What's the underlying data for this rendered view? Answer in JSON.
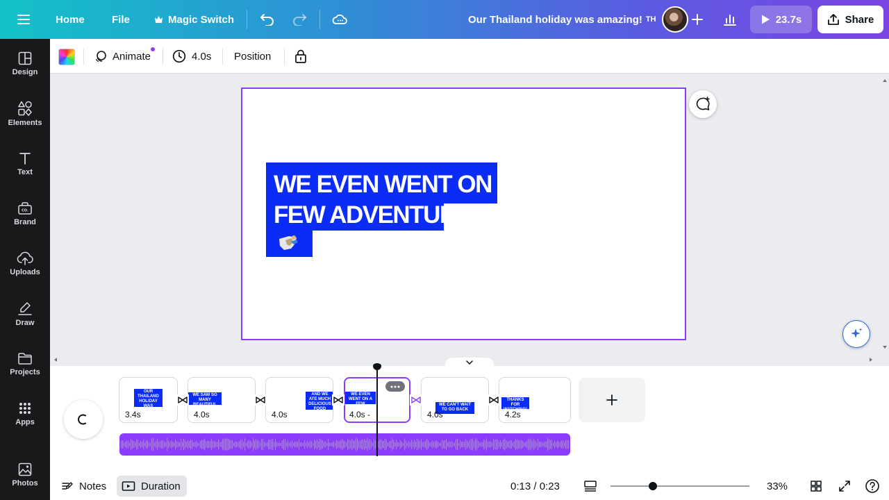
{
  "topbar": {
    "home": "Home",
    "file": "File",
    "magic_switch": "Magic Switch",
    "doc_title": "Our Thailand holiday was amazing!",
    "doc_title_suffix": "TH",
    "play_duration": "23.7s",
    "share": "Share"
  },
  "rail": {
    "items": [
      {
        "label": "Design",
        "icon": "design-icon"
      },
      {
        "label": "Elements",
        "icon": "elements-icon"
      },
      {
        "label": "Text",
        "icon": "text-icon"
      },
      {
        "label": "Brand",
        "icon": "brand-icon"
      },
      {
        "label": "Uploads",
        "icon": "uploads-icon"
      },
      {
        "label": "Draw",
        "icon": "draw-icon"
      },
      {
        "label": "Projects",
        "icon": "projects-icon"
      },
      {
        "label": "Apps",
        "icon": "apps-icon"
      },
      {
        "label": "Photos",
        "icon": "photos-icon"
      }
    ]
  },
  "toolbar": {
    "animate": "Animate",
    "duration": "4.0s",
    "position": "Position"
  },
  "canvas": {
    "headline_line1": "WE EVEN WENT ON A",
    "headline_line2": "FEW ADVENTURES",
    "accent_color": "#0a2cf5",
    "selection_color": "#8b3dff"
  },
  "timeline": {
    "clips": [
      {
        "duration": "3.4s",
        "thumb_text": "OUR THAILAND HOLIDAY WAS AMAZING TH"
      },
      {
        "duration": "4.0s",
        "thumb_text": "WE SAW SO MANY BEAUTIFUL PLACES"
      },
      {
        "duration": "4.0s",
        "thumb_text": "AND WE ATE MUCH DELICIOUS FOOD"
      },
      {
        "duration": "4.0s -",
        "thumb_text": "WE EVEN WENT ON A FEW ADVENTURES"
      },
      {
        "duration": "4.0s",
        "thumb_text": "WE CAN'T WAIT TO GO BACK"
      },
      {
        "duration": "4.2s",
        "thumb_text": "THANKS FOR WATCHING!"
      }
    ]
  },
  "footer": {
    "notes": "Notes",
    "duration": "Duration",
    "time": "0:13 / 0:23",
    "zoom": "33%"
  }
}
